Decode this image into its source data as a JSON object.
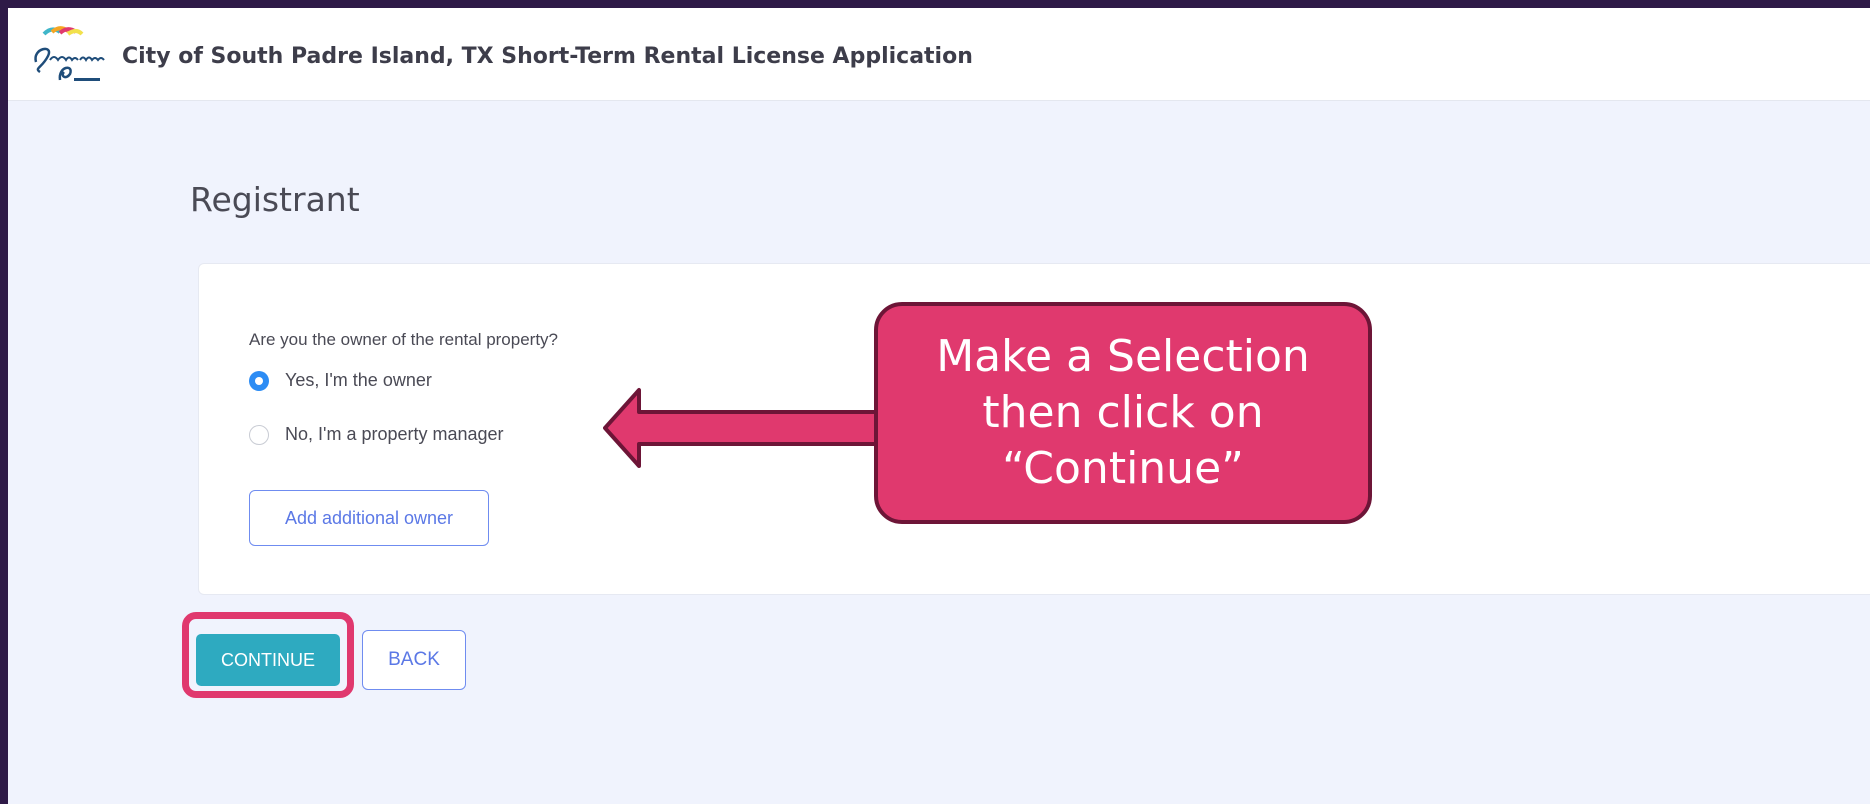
{
  "header": {
    "logo_name": "south-padre-island-logo",
    "app_title": "City of South Padre Island, TX Short-Term Rental License Application"
  },
  "page": {
    "heading": "Registrant"
  },
  "form": {
    "question": "Are you the owner of the rental property?",
    "options": [
      {
        "label": "Yes, I'm the owner",
        "checked": true
      },
      {
        "label": "No, I'm a property manager",
        "checked": false
      }
    ],
    "add_owner_label": "Add additional owner"
  },
  "actions": {
    "continue_label": "CONTINUE",
    "back_label": "BACK"
  },
  "annotation": {
    "callout_text": "Make a Selection\nthen click on\n“Continue”",
    "color": "#e0396e"
  },
  "colors": {
    "primary": "#2eaac0",
    "radio_selected": "#2c8cf4",
    "outline_button": "#6f8cf0",
    "page_bg": "#f0f3fd"
  }
}
